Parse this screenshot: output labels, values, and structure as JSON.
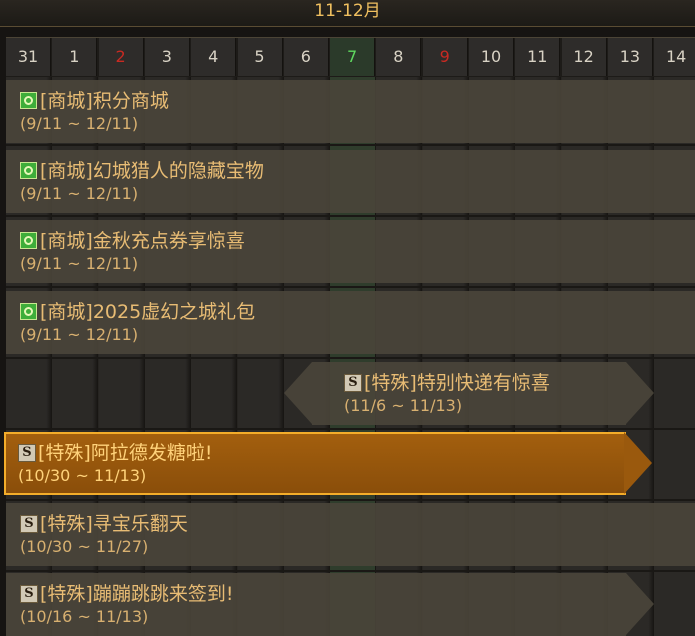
{
  "header": {
    "month_title": "11-12月"
  },
  "days": [
    {
      "label": "31",
      "type": "normal"
    },
    {
      "label": "1",
      "type": "normal"
    },
    {
      "label": "2",
      "type": "red"
    },
    {
      "label": "3",
      "type": "normal"
    },
    {
      "label": "4",
      "type": "normal"
    },
    {
      "label": "5",
      "type": "normal"
    },
    {
      "label": "6",
      "type": "normal"
    },
    {
      "label": "7",
      "type": "green"
    },
    {
      "label": "8",
      "type": "normal"
    },
    {
      "label": "9",
      "type": "red"
    },
    {
      "label": "10",
      "type": "normal"
    },
    {
      "label": "11",
      "type": "normal"
    },
    {
      "label": "12",
      "type": "normal"
    },
    {
      "label": "13",
      "type": "normal"
    },
    {
      "label": "14",
      "type": "normal"
    }
  ],
  "events": [
    {
      "icon": "mall-icon",
      "title": "[商城]积分商城",
      "dates": "(9/11 ~ 12/11)"
    },
    {
      "icon": "mall-icon",
      "title": "[商城]幻城猎人的隐藏宝物",
      "dates": "(9/11 ~ 12/11)"
    },
    {
      "icon": "mall-icon",
      "title": "[商城]金秋充点券享惊喜",
      "dates": "(9/11 ~ 12/11)"
    },
    {
      "icon": "mall-icon",
      "title": "[商城]2025虚幻之城礼包",
      "dates": "(9/11 ~ 12/11)"
    },
    {
      "icon": "special-icon",
      "title": "[特殊]特别快递有惊喜",
      "dates": "(11/6 ~ 11/13)"
    },
    {
      "icon": "special-icon",
      "title": "[特殊]阿拉德发糖啦!",
      "dates": "(10/30 ~ 11/13)",
      "selected": true
    },
    {
      "icon": "special-icon",
      "title": "[特殊]寻宝乐翻天",
      "dates": "(10/30 ~ 11/27)"
    },
    {
      "icon": "special-icon",
      "title": "[特殊]蹦蹦跳跳来签到!",
      "dates": "(10/16 ~ 11/13)"
    }
  ],
  "icons": {
    "special_glyph": "S"
  },
  "colors": {
    "accent": "#f4ad2a",
    "today": "#5fd85f",
    "holiday": "#c82a22",
    "text": "#e8bc74"
  }
}
